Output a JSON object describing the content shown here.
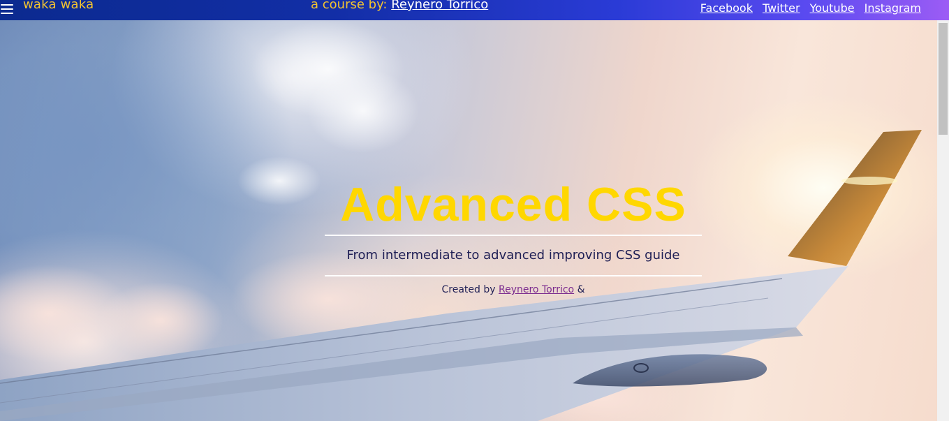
{
  "navbar": {
    "menu_icon": "hamburger-menu-icon",
    "brand": "waka waka",
    "course_prefix": "a course by:",
    "course_author": "Reynero Torrico",
    "social_links": [
      "Facebook",
      "Twitter",
      "Youtube",
      "Instagram"
    ],
    "colors": {
      "brand_text": "#f4c430",
      "link_text": "#ffffff",
      "gradient_start": "#0b2a8f",
      "gradient_end": "#9c5cf5"
    }
  },
  "hero": {
    "background": "airplane wing above clouds at sunset",
    "title": "Advanced CSS",
    "subtitle": "From intermediate to advanced improving CSS guide",
    "credits_prefix": "Created by",
    "credits_author": "Reynero Torrico",
    "credits_suffix": "&",
    "colors": {
      "title": "#ffd700",
      "subtitle": "#1f1f55",
      "rule": "#ffffff",
      "author_link": "#7b2b8f"
    }
  }
}
